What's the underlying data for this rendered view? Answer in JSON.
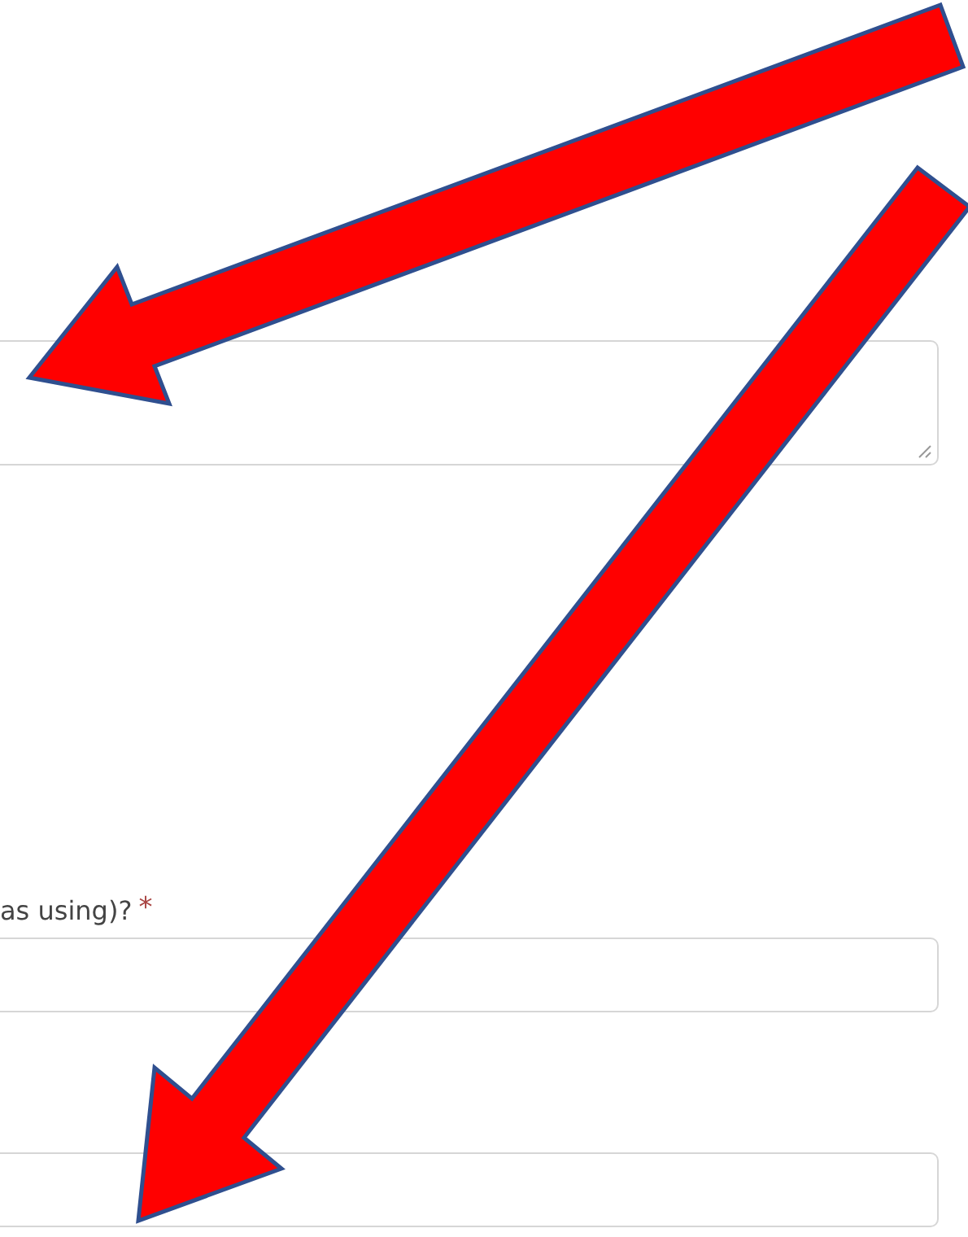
{
  "fields": [
    {
      "kind": "textarea"
    },
    {
      "kind": "input",
      "label": "as using)?",
      "required_mark": "*"
    },
    {
      "kind": "input"
    }
  ],
  "annotations": [
    {
      "kind": "arrow"
    },
    {
      "kind": "arrow"
    }
  ]
}
